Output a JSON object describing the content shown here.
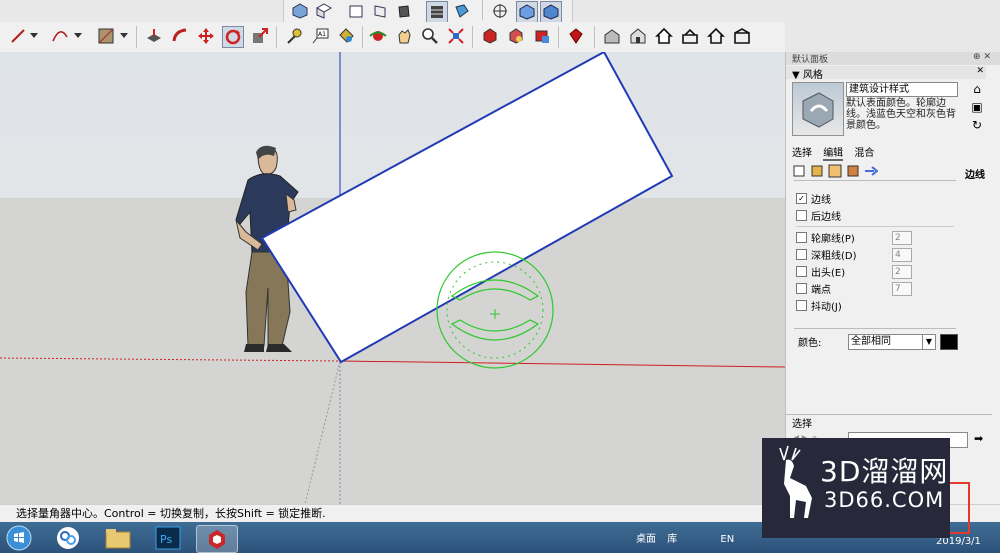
{
  "top_toolbar": {
    "icons": [
      "iso-view-icon",
      "top-view-icon",
      "front-view-icon",
      "right-view-icon",
      "back-view-icon",
      "left-view-icon",
      "xray-icon",
      "wireframe-icon",
      "section-icon",
      "shaded-icon",
      "orbit-icon"
    ]
  },
  "main_toolbar": {
    "icons": [
      "pencil-icon",
      "arc-icon",
      "rectangle-icon",
      "push-pull-icon",
      "follow-me-icon",
      "move-icon",
      "rotate-icon",
      "scale-icon",
      "tape-measure-icon",
      "text-icon",
      "paint-bucket-icon",
      "orbit-icon",
      "pan-icon",
      "zoom-icon",
      "zoom-extents-icon",
      "component-icon",
      "materials-icon",
      "camera-icon",
      "ruby-icon",
      "warehouse-icon",
      "house-front-icon",
      "house-icon",
      "house-outline-icon",
      "house-open-icon"
    ]
  },
  "panel": {
    "header": "默认面板",
    "section": "▼ 风格",
    "style_name": "建筑设计样式",
    "style_description": "默认表面颜色。轮廓边线。浅蓝色天空和灰色背景颜色。",
    "tabs": [
      {
        "label": "选择",
        "active": false
      },
      {
        "label": "编辑",
        "active": true
      },
      {
        "label": "混合",
        "active": false
      }
    ],
    "edge_title": "边线",
    "options": [
      {
        "label": "边线",
        "checked": true,
        "value": ""
      },
      {
        "label": "后边线",
        "checked": false,
        "value": ""
      },
      {
        "label": "轮廓线(P)",
        "checked": false,
        "value": "2"
      },
      {
        "label": "深粗线(D)",
        "checked": false,
        "value": "4"
      },
      {
        "label": "出头(E)",
        "checked": false,
        "value": "2"
      },
      {
        "label": "端点",
        "checked": false,
        "value": "7"
      },
      {
        "label": "抖动(J)",
        "checked": false,
        "value": ""
      }
    ],
    "color_label": "颜色:",
    "color_value": "全部相同",
    "color_swatch": "#000000",
    "select_label": "选择"
  },
  "status_bar": {
    "text": "选择量角器中心。Control = 切换复制，长按Shift = 锁定推断."
  },
  "watermark": {
    "logo": "3D溜溜网",
    "url": "3D66.COM"
  },
  "taskbar": {
    "apps": [
      "ie-icon",
      "baidu-netdisk-icon",
      "explorer-icon",
      "photoshop-icon",
      "sketchup-icon"
    ],
    "ps_label": "Ps",
    "tray_text": "桌面",
    "tray_lib": "库",
    "lang": "EN",
    "date": "2019/3/1"
  },
  "colors": {
    "rect_edge": "#1f3ab4",
    "protractor": "#2fc82f",
    "axis_red": "#cc2222",
    "axis_blue": "#2233bb",
    "axis_green": "#2aa52a"
  }
}
